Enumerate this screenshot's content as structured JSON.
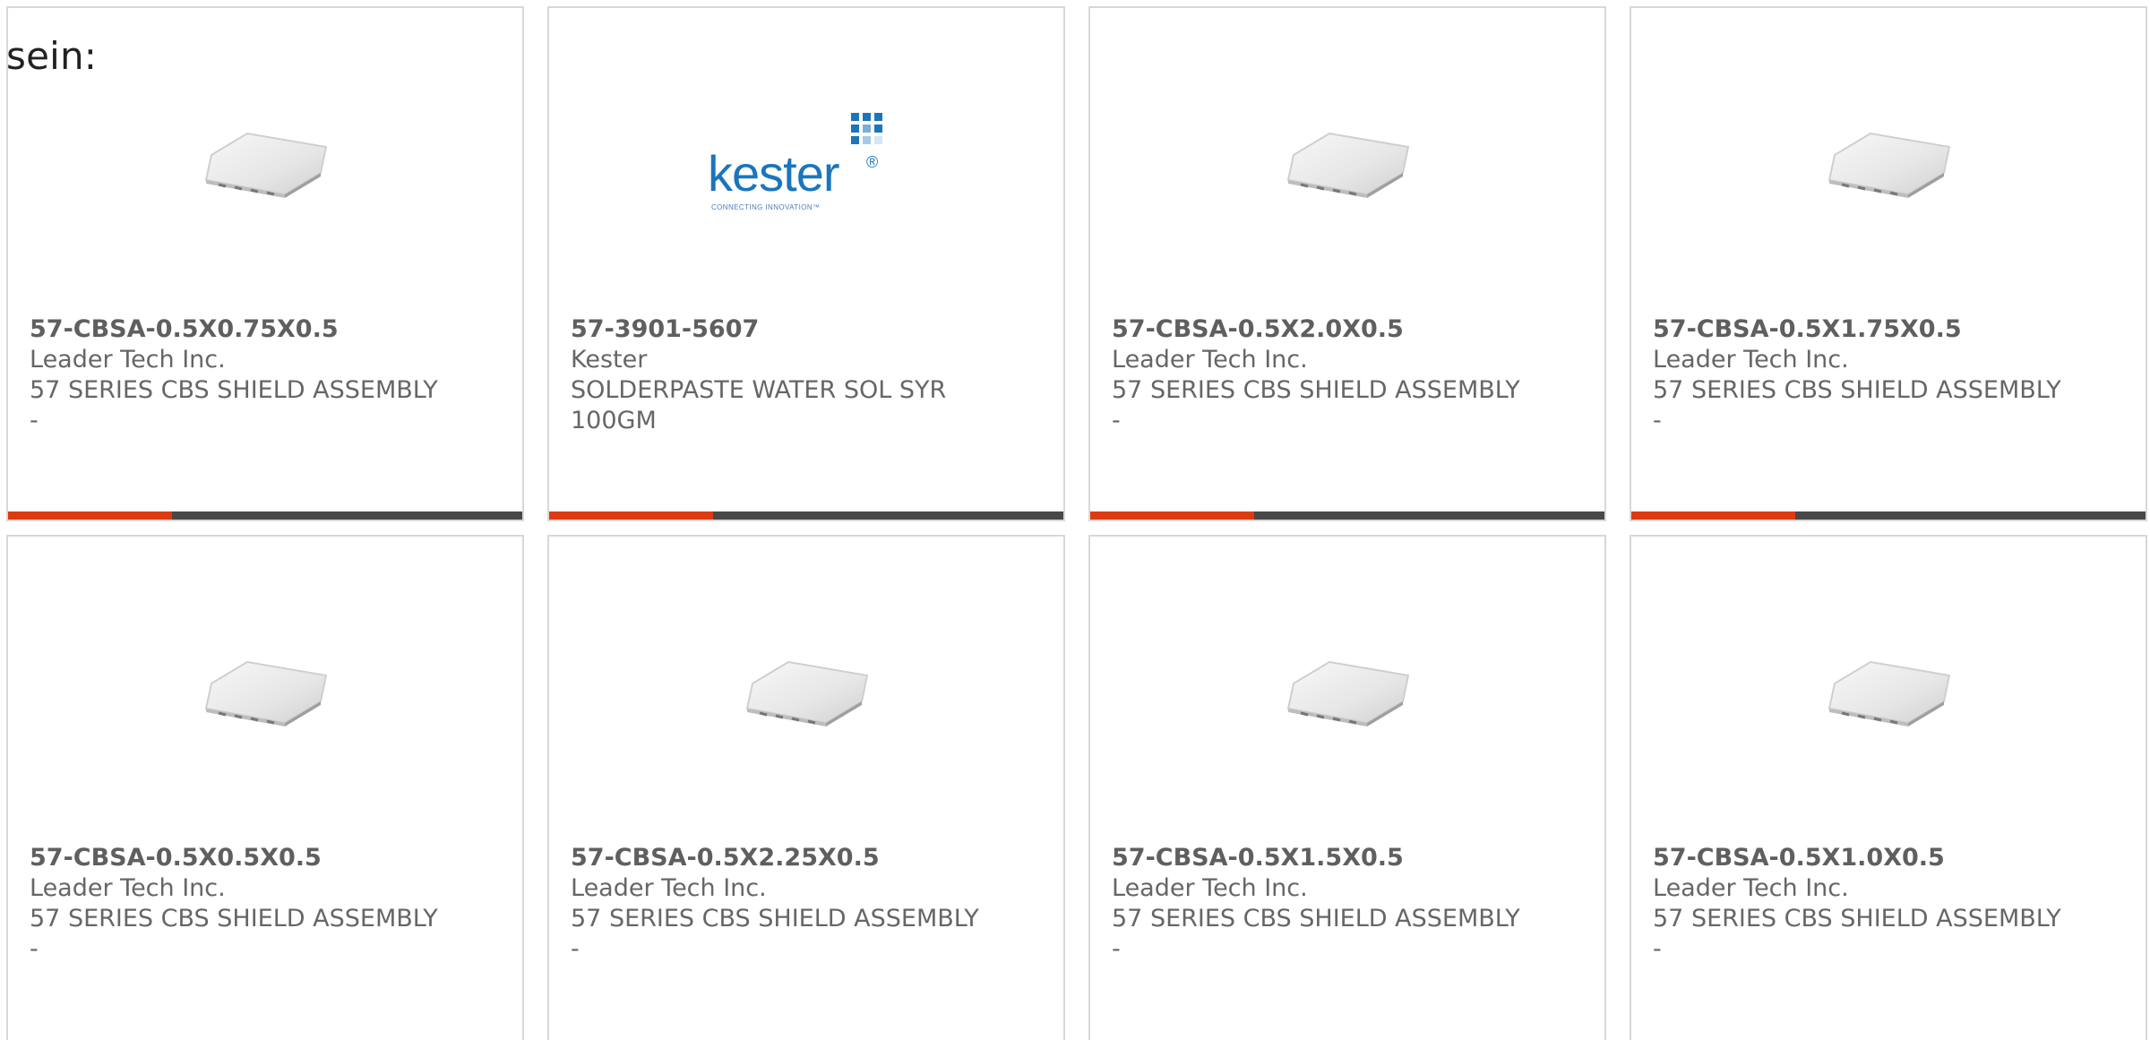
{
  "page": {
    "intro_text": "sein:"
  },
  "colors": {
    "accent": "#dc3b12",
    "bar_dark": "#484848",
    "card_border": "#d8d8d8",
    "text": "#666666"
  },
  "cards": [
    {
      "part_number": "57-CBSA-0.5X0.75X0.5",
      "manufacturer": "Leader Tech Inc.",
      "description": "57 SERIES CBS SHIELD ASSEMBLY -",
      "image_icon": "shield-assembly-image"
    },
    {
      "part_number": "57-3901-5607",
      "manufacturer": "Kester",
      "description": "SOLDERPASTE WATER SOL SYR 100GM",
      "image_icon": "kester-logo",
      "logo": {
        "wordmark": "kester",
        "trademark": "®",
        "tagline": "CONNECTING INNOVATION™"
      }
    },
    {
      "part_number": "57-CBSA-0.5X2.0X0.5",
      "manufacturer": "Leader Tech Inc.",
      "description": "57 SERIES CBS SHIELD ASSEMBLY -",
      "image_icon": "shield-assembly-image"
    },
    {
      "part_number": "57-CBSA-0.5X1.75X0.5",
      "manufacturer": "Leader Tech Inc.",
      "description": "57 SERIES CBS SHIELD ASSEMBLY -",
      "image_icon": "shield-assembly-image"
    },
    {
      "part_number": "57-CBSA-0.5X0.5X0.5",
      "manufacturer": "Leader Tech Inc.",
      "description": "57 SERIES CBS SHIELD ASSEMBLY -",
      "image_icon": "shield-assembly-image"
    },
    {
      "part_number": "57-CBSA-0.5X2.25X0.5",
      "manufacturer": "Leader Tech Inc.",
      "description": "57 SERIES CBS SHIELD ASSEMBLY -",
      "image_icon": "shield-assembly-image"
    },
    {
      "part_number": "57-CBSA-0.5X1.5X0.5",
      "manufacturer": "Leader Tech Inc.",
      "description": "57 SERIES CBS SHIELD ASSEMBLY -",
      "image_icon": "shield-assembly-image"
    },
    {
      "part_number": "57-CBSA-0.5X1.0X0.5",
      "manufacturer": "Leader Tech Inc.",
      "description": "57 SERIES CBS SHIELD ASSEMBLY -",
      "image_icon": "shield-assembly-image"
    }
  ]
}
